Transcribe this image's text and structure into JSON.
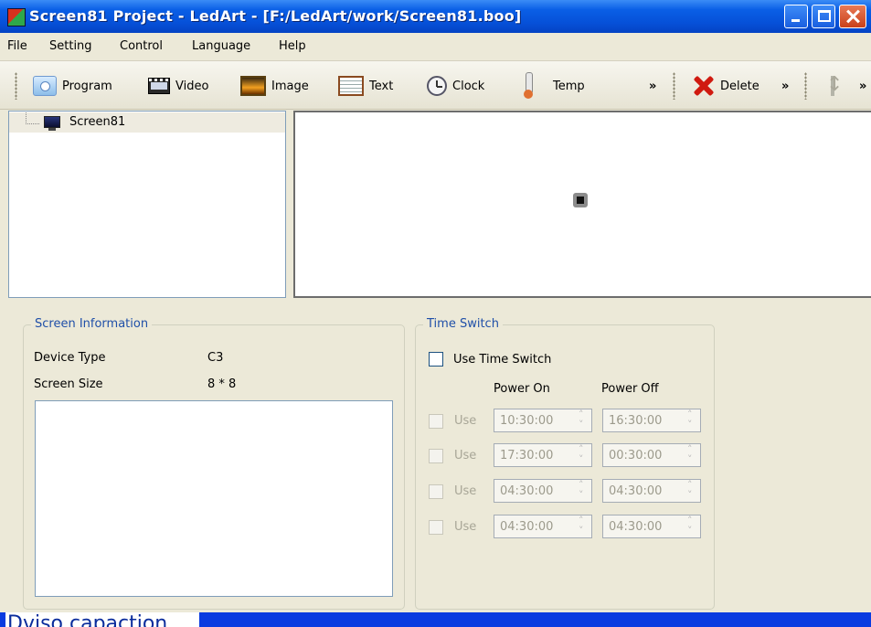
{
  "window": {
    "title": "Screen81 Project - LedArt - [F:/LedArt/work/Screen81.boo]"
  },
  "menu": {
    "items": [
      "File",
      "Setting",
      "Control",
      "Language",
      "Help"
    ]
  },
  "toolbar": {
    "program": "Program",
    "video": "Video",
    "image": "Image",
    "text": "Text",
    "clock": "Clock",
    "temp": "Temp",
    "more1": "»",
    "delete": "Delete",
    "more2": "»",
    "more3": "»"
  },
  "tree": {
    "items": [
      {
        "label": "Screen81",
        "icon": "monitor-icon"
      }
    ]
  },
  "screen_info": {
    "title": "Screen Information",
    "device_type_label": "Device Type",
    "device_type_value": "C3",
    "screen_size_label": "Screen Size",
    "screen_size_value": "8 * 8"
  },
  "time_switch": {
    "title": "Time Switch",
    "use_time_switch": "Use Time Switch",
    "power_on_header": "Power On",
    "power_off_header": "Power Off",
    "rows": [
      {
        "use": "Use",
        "on": "10:30:00",
        "off": "16:30:00"
      },
      {
        "use": "Use",
        "on": "17:30:00",
        "off": "00:30:00"
      },
      {
        "use": "Use",
        "on": "04:30:00",
        "off": "04:30:00"
      },
      {
        "use": "Use",
        "on": "04:30:00",
        "off": "04:30:00"
      }
    ]
  },
  "bottom": {
    "label": "Dviso capaction"
  }
}
